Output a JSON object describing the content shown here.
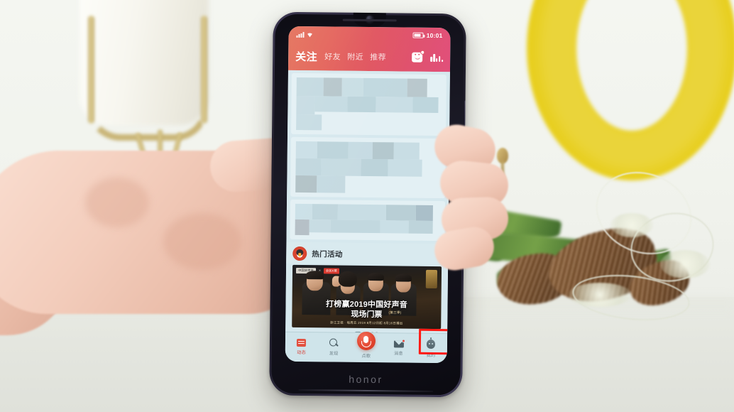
{
  "scene": {
    "description": "Hand holding an honor smartphone showing a Chinese karaoke social app; decorative yellow ring, pine cones and pine branches on a light table",
    "phone_brand": "honor"
  },
  "status_bar": {
    "time": "10:01",
    "signal_icon": "signal-bars-icon",
    "wifi_icon": "wifi-icon",
    "battery_icon": "battery-icon"
  },
  "header": {
    "tabs": [
      {
        "label": "关注",
        "active": true
      },
      {
        "label": "好友",
        "active": false
      },
      {
        "label": "附近",
        "active": false
      },
      {
        "label": "推荐",
        "active": false
      }
    ],
    "actions": [
      {
        "name": "sticker-camera-icon",
        "badge": true
      },
      {
        "name": "ranking-chart-icon",
        "badge": false
      }
    ],
    "gradient_from": "#e2674f",
    "gradient_to": "#e1507b"
  },
  "feed": {
    "censored_note": "内容已打码",
    "hot_section": {
      "avatar_icon": "penguin-avatar-icon",
      "title": "热门活动"
    },
    "banner": {
      "title_line1": "打榜赢2019中国好声音",
      "title_line2": "现场门票",
      "title_suffix": "(第三季)",
      "footer": "浙江卫视 · 每周五 2019 8月12日起 8月16日播出",
      "brand_left": "中国好声音",
      "brand_x": "×",
      "brand_right": "全民K歌"
    },
    "carousel": {
      "total": 5,
      "current": 1
    }
  },
  "bottom_nav": [
    {
      "label": "动态",
      "icon": "feed-icon",
      "active": true,
      "badge": false
    },
    {
      "label": "发现",
      "icon": "search-icon",
      "active": false,
      "badge": false
    },
    {
      "label": "点歌",
      "icon": "microphone-icon",
      "active": false,
      "badge": false
    },
    {
      "label": "消息",
      "icon": "envelope-icon",
      "active": false,
      "badge": true
    },
    {
      "label": "我的",
      "icon": "profile-robot-icon",
      "active": false,
      "badge": false
    }
  ],
  "annotation": {
    "type": "red-highlight-box",
    "target_label": "我的",
    "color": "#ff1a14"
  }
}
